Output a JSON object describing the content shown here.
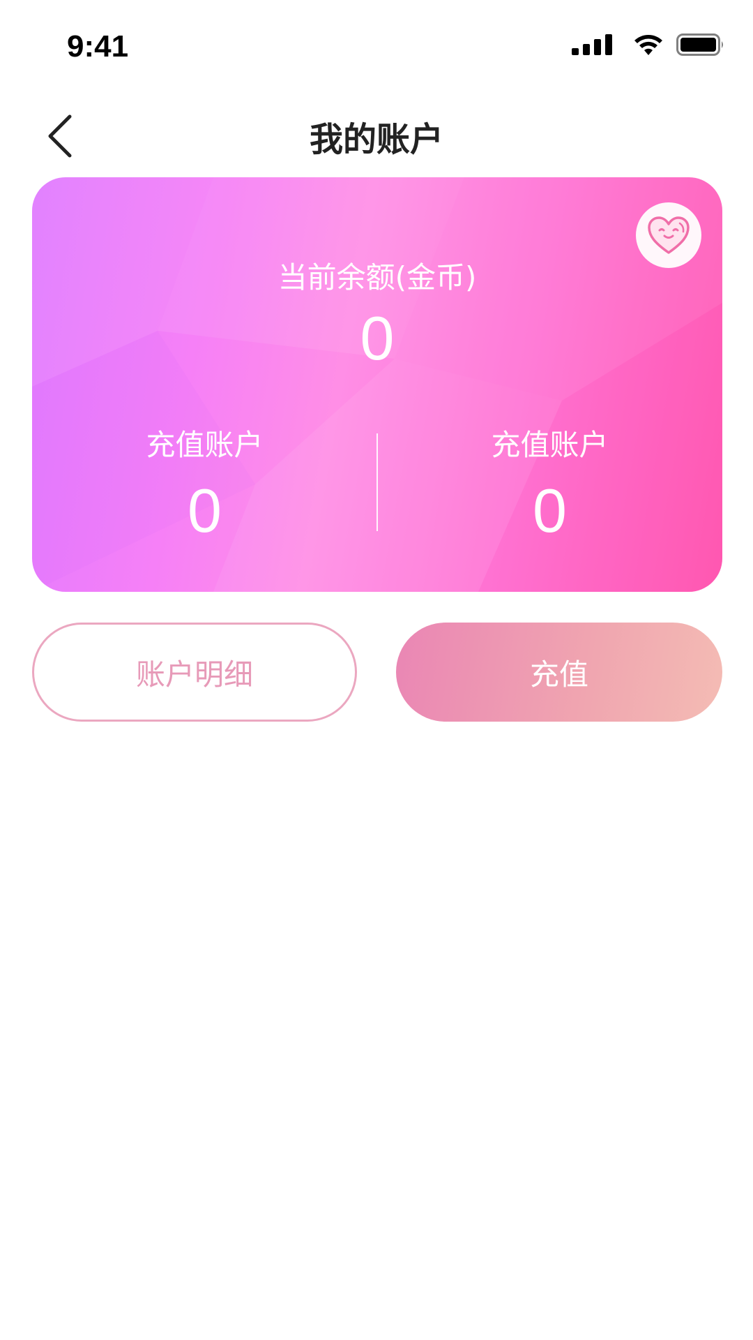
{
  "status_bar": {
    "time": "9:41",
    "icons": [
      "cellular-signal-icon",
      "wifi-icon",
      "battery-icon"
    ]
  },
  "header": {
    "back_icon": "chevron-left-icon",
    "title": "我的账户"
  },
  "balance_card": {
    "badge_icon": "heart-smile-icon",
    "balance_label": "当前余额(金币)",
    "balance_value": "0",
    "accounts": [
      {
        "label": "充值账户",
        "value": "0"
      },
      {
        "label": "充值账户",
        "value": "0"
      }
    ],
    "colors": {
      "gradient_start": "#e07bff",
      "gradient_end": "#ff59b2"
    }
  },
  "actions": {
    "details_label": "账户明细",
    "recharge_label": "充值",
    "colors": {
      "details_border": "#eba7c0",
      "details_text": "#e79ab8",
      "recharge_start": "#ea86b4",
      "recharge_end": "#f4bcb4"
    }
  }
}
